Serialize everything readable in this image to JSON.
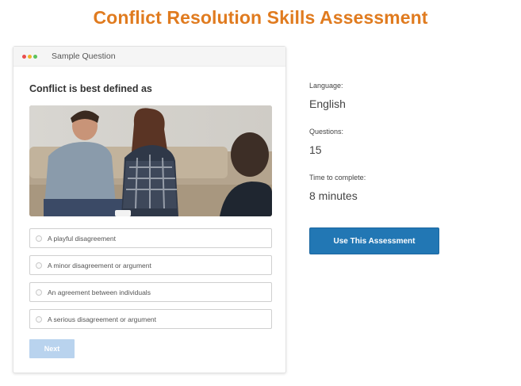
{
  "page": {
    "title": "Conflict Resolution Skills Assessment"
  },
  "sample_card": {
    "header_label": "Sample Question",
    "window_dots": [
      "red",
      "yellow",
      "green"
    ],
    "question": "Conflict is best defined as",
    "options": [
      "A playful disagreement",
      "A minor disagreement or argument",
      "An agreement between individuals",
      "A serious disagreement or argument"
    ],
    "next_label": "Next"
  },
  "details": {
    "language_label": "Language:",
    "language_value": "English",
    "questions_label": "Questions:",
    "questions_value": "15",
    "time_label": "Time to complete:",
    "time_value": "8 minutes"
  },
  "cta": {
    "use_label": "Use This Assessment"
  },
  "colors": {
    "title": "#e07b1f",
    "primary_button": "#2277b4",
    "next_button_disabled": "#b9d3ee"
  }
}
